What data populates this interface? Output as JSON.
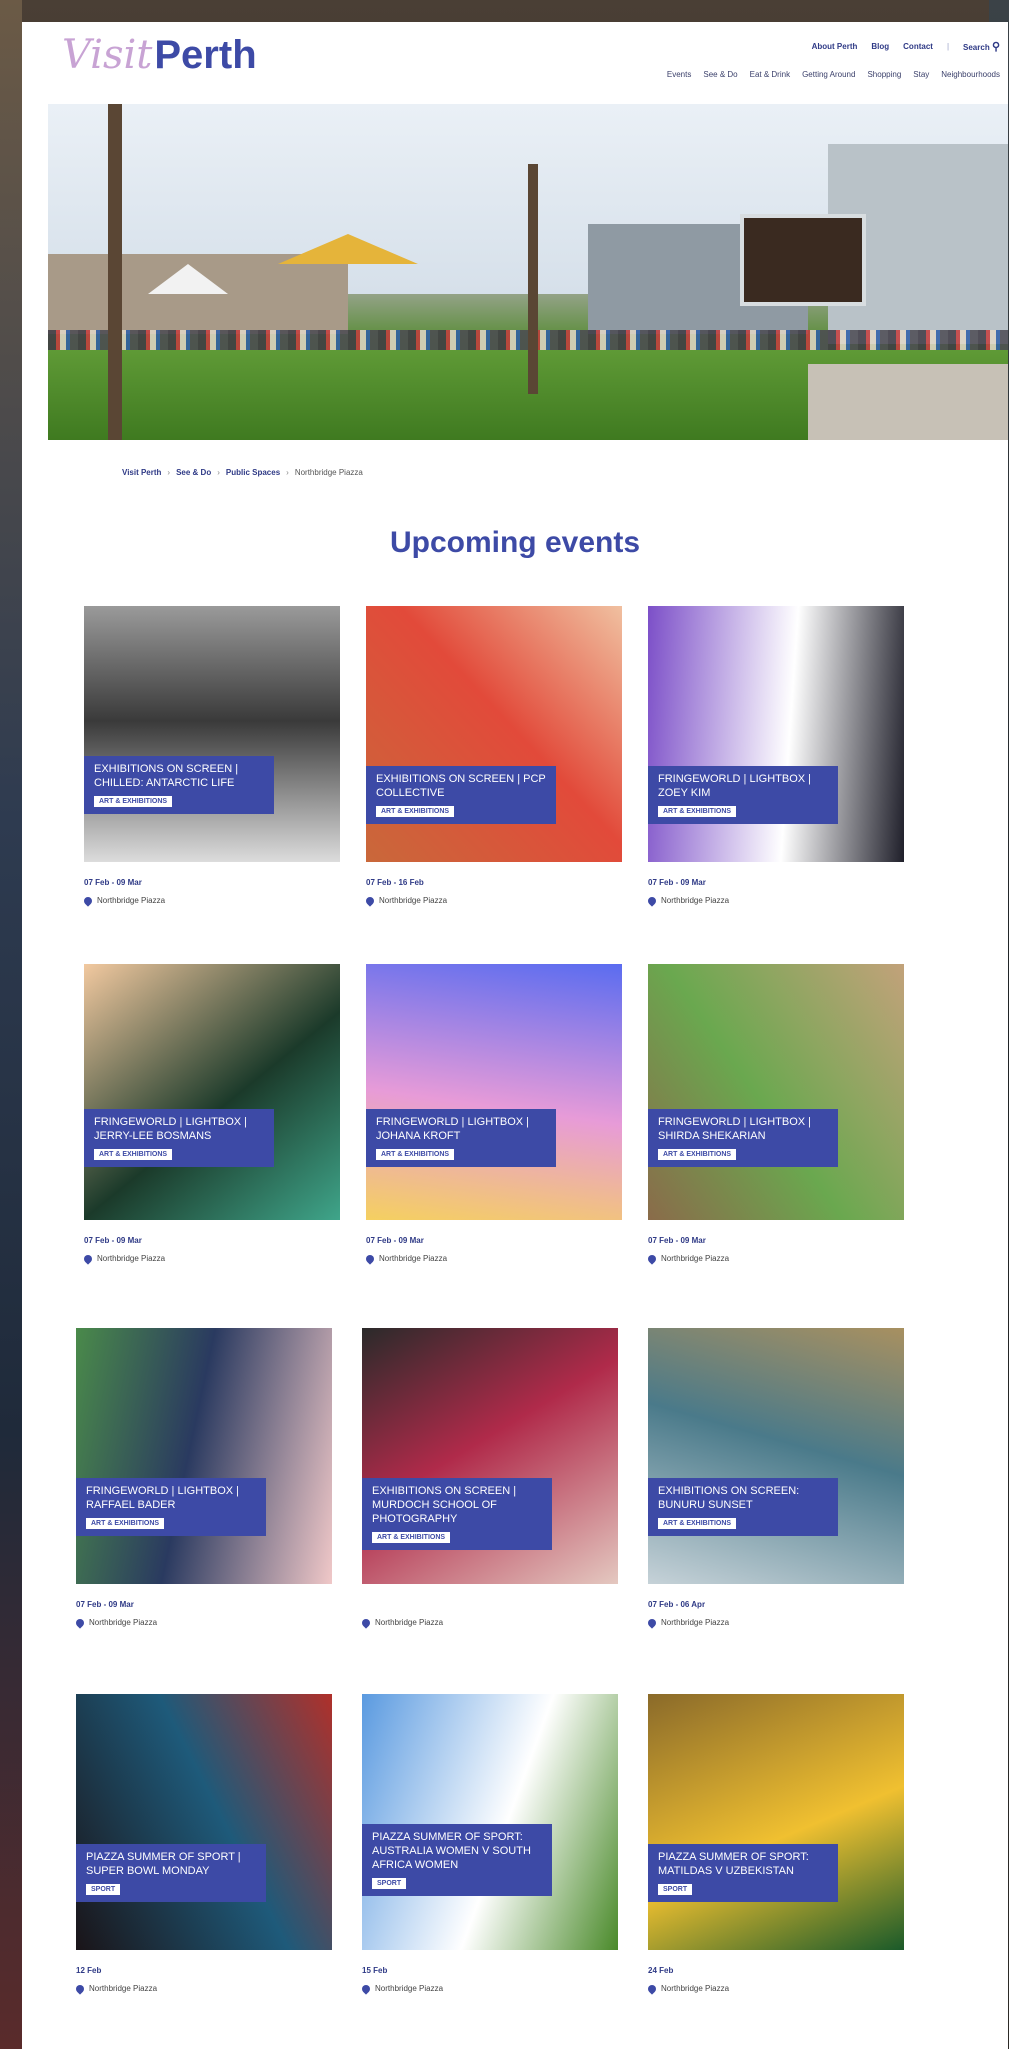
{
  "header": {
    "logo_visit": "Visit",
    "logo_perth": "Perth",
    "utility_nav": [
      "About Perth",
      "Blog",
      "Contact"
    ],
    "search_label": "Search",
    "main_nav": [
      "Events",
      "See & Do",
      "Eat & Drink",
      "Getting Around",
      "Shopping",
      "Stay",
      "Neighbourhoods"
    ]
  },
  "breadcrumb": {
    "items": [
      "Visit Perth",
      "See & Do",
      "Public Spaces"
    ],
    "current": "Northbridge Piazza"
  },
  "section_title": "Upcoming events",
  "events": [
    {
      "title": "Exhibitions on Screen | Chilled: Antarctic Life",
      "tag": "Art & Exhibitions",
      "date": "07 Feb - 09 Mar",
      "location": "Northbridge Piazza",
      "colors": [
        "#dcdcdc",
        "#3a3a3a",
        "#9a9a9a"
      ]
    },
    {
      "title": "Exhibitions on Screen | PCP Collective",
      "tag": "Art & Exhibitions",
      "date": "07 Feb - 16 Feb",
      "location": "Northbridge Piazza",
      "colors": [
        "#c9683a",
        "#e24a3a",
        "#f0c0a0"
      ]
    },
    {
      "title": "Fringeworld | Lightbox | Zoey Kim",
      "tag": "Art & Exhibitions",
      "date": "07 Feb - 09 Mar",
      "location": "Northbridge Piazza",
      "colors": [
        "#7c4fc8",
        "#ffffff",
        "#1f1f2a"
      ]
    },
    {
      "title": "Fringeworld | Lightbox | Jerry-Lee Bosmans",
      "tag": "Art & Exhibitions",
      "date": "07 Feb - 09 Mar",
      "location": "Northbridge Piazza",
      "colors": [
        "#f2c9a0",
        "#1b3a2a",
        "#3fa58a"
      ]
    },
    {
      "title": "Fringeworld | Lightbox | Johana Kroft",
      "tag": "Art & Exhibitions",
      "date": "07 Feb - 09 Mar",
      "location": "Northbridge Piazza",
      "colors": [
        "#5a6cf0",
        "#e79bd8",
        "#f5d060"
      ]
    },
    {
      "title": "Fringeworld | Lightbox | Shirda Shekarian",
      "tag": "Art & Exhibitions",
      "date": "07 Feb - 09 Mar",
      "location": "Northbridge Piazza",
      "colors": [
        "#c2a27a",
        "#6aa84f",
        "#8a6b4a"
      ]
    },
    {
      "title": "Fringeworld | Lightbox | Raffael Bader",
      "tag": "Art & Exhibitions",
      "date": "07 Feb - 09 Mar",
      "location": "Northbridge Piazza",
      "colors": [
        "#f0c8c8",
        "#2a3a60",
        "#4a8a4a"
      ]
    },
    {
      "title": "Exhibitions on Screen | Murdoch School of Photography",
      "tag": "Art & Exhibitions",
      "date": "",
      "location": "Northbridge Piazza",
      "colors": [
        "#e4c8c0",
        "#b02a4a",
        "#2a2a2a"
      ]
    },
    {
      "title": "Exhibitions on Screen: Bunuru Sunset",
      "tag": "Art & Exhibitions",
      "date": "07 Feb - 06 Apr",
      "location": "Northbridge Piazza",
      "colors": [
        "#c6d2d8",
        "#4a7a8a",
        "#a89060"
      ]
    },
    {
      "title": "Piazza Summer of Sport | Super Bowl Monday",
      "tag": "Sport",
      "date": "12 Feb",
      "location": "Northbridge Piazza",
      "colors": [
        "#1a1418",
        "#1e5a7a",
        "#b0302a"
      ]
    },
    {
      "title": "Piazza Summer of Sport: Australia Women v South Africa Women",
      "tag": "Sport",
      "date": "15 Feb",
      "location": "Northbridge Piazza",
      "colors": [
        "#5a9ae0",
        "#ffffff",
        "#4a8a2a"
      ]
    },
    {
      "title": "Piazza Summer of Sport: Matildas v Uzbekistan",
      "tag": "Sport",
      "date": "24 Feb",
      "location": "Northbridge Piazza",
      "colors": [
        "#8a6a2a",
        "#f0c030",
        "#1a5a2a"
      ]
    }
  ],
  "colors": {
    "brand": "#3d4aa6",
    "logo_accent": "#c8a3d4"
  }
}
